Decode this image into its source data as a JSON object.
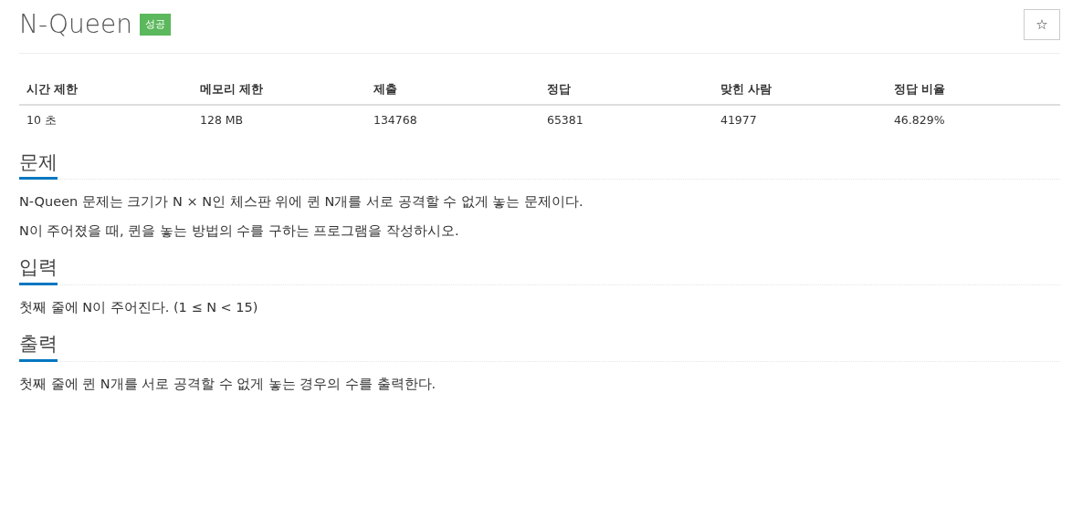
{
  "title": "N-Queen",
  "badge": {
    "label": "성공",
    "kind": "success"
  },
  "star_button": {
    "label": "☆"
  },
  "table": {
    "columns": [
      "시간 제한",
      "메모리 제한",
      "제출",
      "정답",
      "맞힌 사람",
      "정답 비율"
    ],
    "rows": [
      [
        "10 초",
        "128 MB",
        "134768",
        "65381",
        "41977",
        "46.829%"
      ]
    ]
  },
  "sections": [
    {
      "heading": "문제",
      "paragraphs": [
        "N-Queen 문제는 크기가 N × N인 체스판 위에 퀸 N개를 서로 공격할 수 없게 놓는 문제이다.",
        "N이 주어졌을 때, 퀸을 놓는 방법의 수를 구하는 프로그램을 작성하시오."
      ]
    },
    {
      "heading": "입력",
      "paragraphs": [
        "첫째 줄에 N이 주어진다. (1 ≤ N < 15)"
      ]
    },
    {
      "heading": "출력",
      "paragraphs": [
        "첫째 줄에 퀸 N개를 서로 공격할 수 없게 놓는 경우의 수를 출력한다."
      ]
    }
  ]
}
